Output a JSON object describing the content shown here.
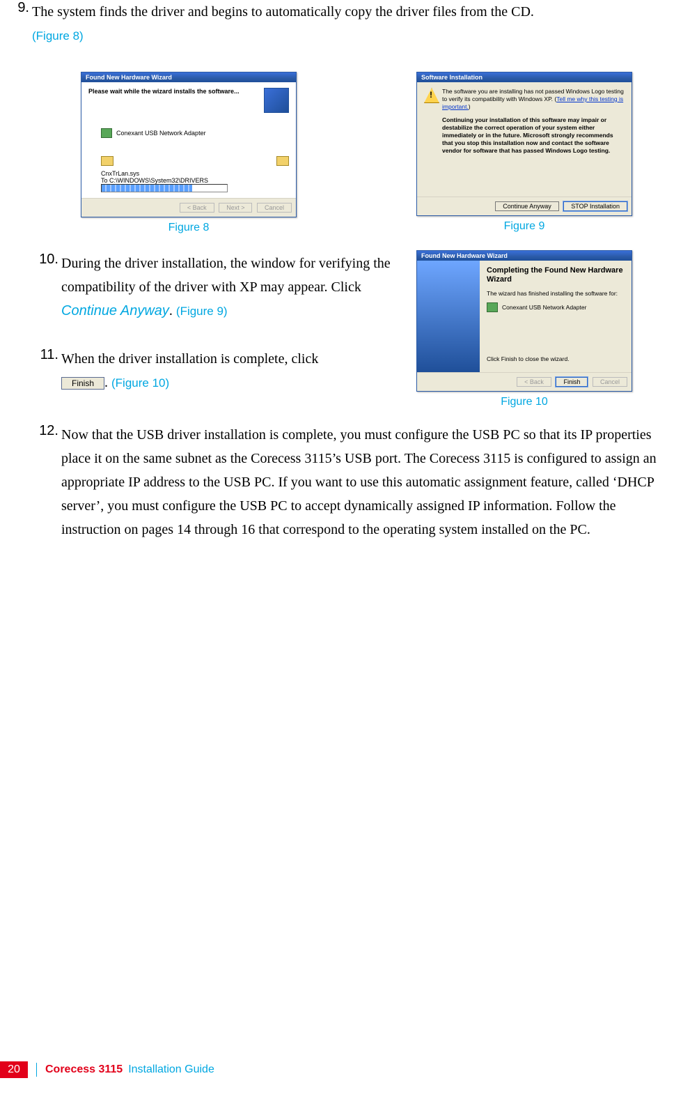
{
  "steps": {
    "s9": {
      "num": "9.",
      "text_a": "The system finds the driver and begins to automatically copy the driver files from the CD.",
      "figref": "(Figure 8)"
    },
    "s10": {
      "num": "10.",
      "text_a": "During the driver installation, the window for verifying the compatibility of the driver with XP may appear. Click ",
      "action": "Continue Anyway",
      "text_b": ". ",
      "figref": "(Figure 9)"
    },
    "s11": {
      "num": "11.",
      "text_a": "When the driver installation is complete, click ",
      "button_label": "Finish",
      "text_b": ". ",
      "figref": "(Figure 10)"
    },
    "s12": {
      "num": "12.",
      "text": "Now that the USB driver installation is complete, you must configure the USB PC so that its IP properties place it on the same subnet as the Corecess 3115’s USB port. The Corecess 3115 is configured to assign an appropriate IP address to the USB PC. If you want to use this automatic assignment feature, called ‘DHCP server’, you must configure the USB PC to accept dynamically assigned IP information. Follow the instruction on pages 14 through 16 that correspond to the operating system installed on the PC."
    }
  },
  "captions": {
    "fig8": "Figure 8",
    "fig9": "Figure 9",
    "fig10": "Figure 10"
  },
  "dialogs": {
    "fig8": {
      "title": "Found New Hardware Wizard",
      "line1": "Please wait while the wizard installs the software...",
      "device": "Conexant USB Network Adapter",
      "file": "CnxTrLan.sys",
      "dest": "To C:\\WINDOWS\\System32\\DRIVERS",
      "btn_back": "< Back",
      "btn_next": "Next >",
      "btn_cancel": "Cancel"
    },
    "fig9": {
      "title": "Software Installation",
      "msg1": "The software you are installing has not passed Windows Logo testing to verify its compatibility with Windows XP. (",
      "link": "Tell me why this testing is important.",
      "msg1b": ")",
      "msg2": "Continuing your installation of this software may impair or destabilize the correct operation of your system either immediately or in the future. Microsoft strongly recommends that you stop this installation now and contact the software vendor for software that has passed Windows Logo testing.",
      "btn_continue": "Continue Anyway",
      "btn_stop": "STOP Installation"
    },
    "fig10": {
      "title": "Found New Hardware Wizard",
      "heading": "Completing the Found New Hardware Wizard",
      "line1": "The wizard has finished installing the software for:",
      "device": "Conexant USB Network Adapter",
      "line2": "Click Finish to close the wizard.",
      "btn_back": "< Back",
      "btn_finish": "Finish",
      "btn_cancel": "Cancel"
    }
  },
  "footer": {
    "page": "20",
    "product": "Corecess 3115",
    "guide": "Installation Guide"
  }
}
